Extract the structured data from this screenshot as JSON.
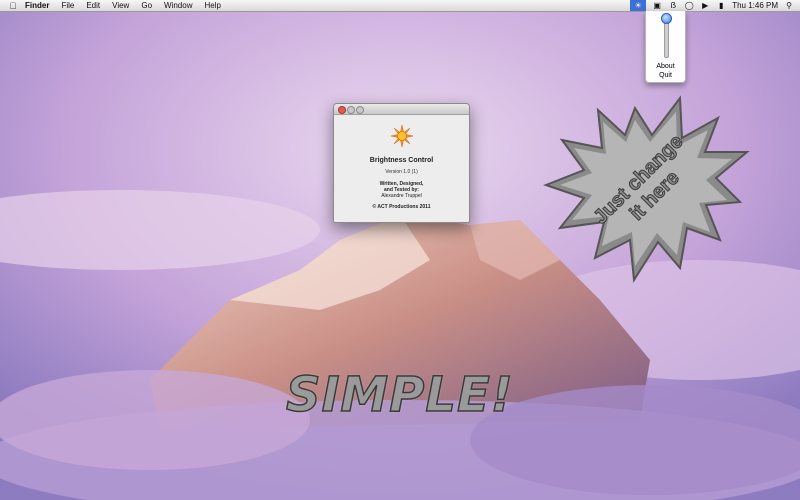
{
  "menubar": {
    "app_name": "Finder",
    "menus": [
      "File",
      "Edit",
      "View",
      "Go",
      "Window",
      "Help"
    ],
    "status_icons": [
      "brightness-icon",
      "display-icon",
      "bluetooth-icon",
      "wifi-icon",
      "volume-icon",
      "battery-icon"
    ],
    "clock": "Thu 1:46 PM"
  },
  "brightness_menu": {
    "level": 1.0,
    "items": [
      "About",
      "Quit"
    ]
  },
  "about_window": {
    "app_name": "Brightness Control",
    "version": "Version 1.0 (1)",
    "credits_line1": "Written, Designed,",
    "credits_line2": "and Tested by:",
    "author": "Alexandre Truppel",
    "copyright": "© ACT Productions 2011"
  },
  "promo": {
    "starburst_line1": "Just change",
    "starburst_line2": "it here",
    "simple": "SIMPLE!"
  },
  "colors": {
    "accent": "#3d6fd9",
    "close_button": "#e6584f",
    "promo_text": "#9a9a9a"
  }
}
